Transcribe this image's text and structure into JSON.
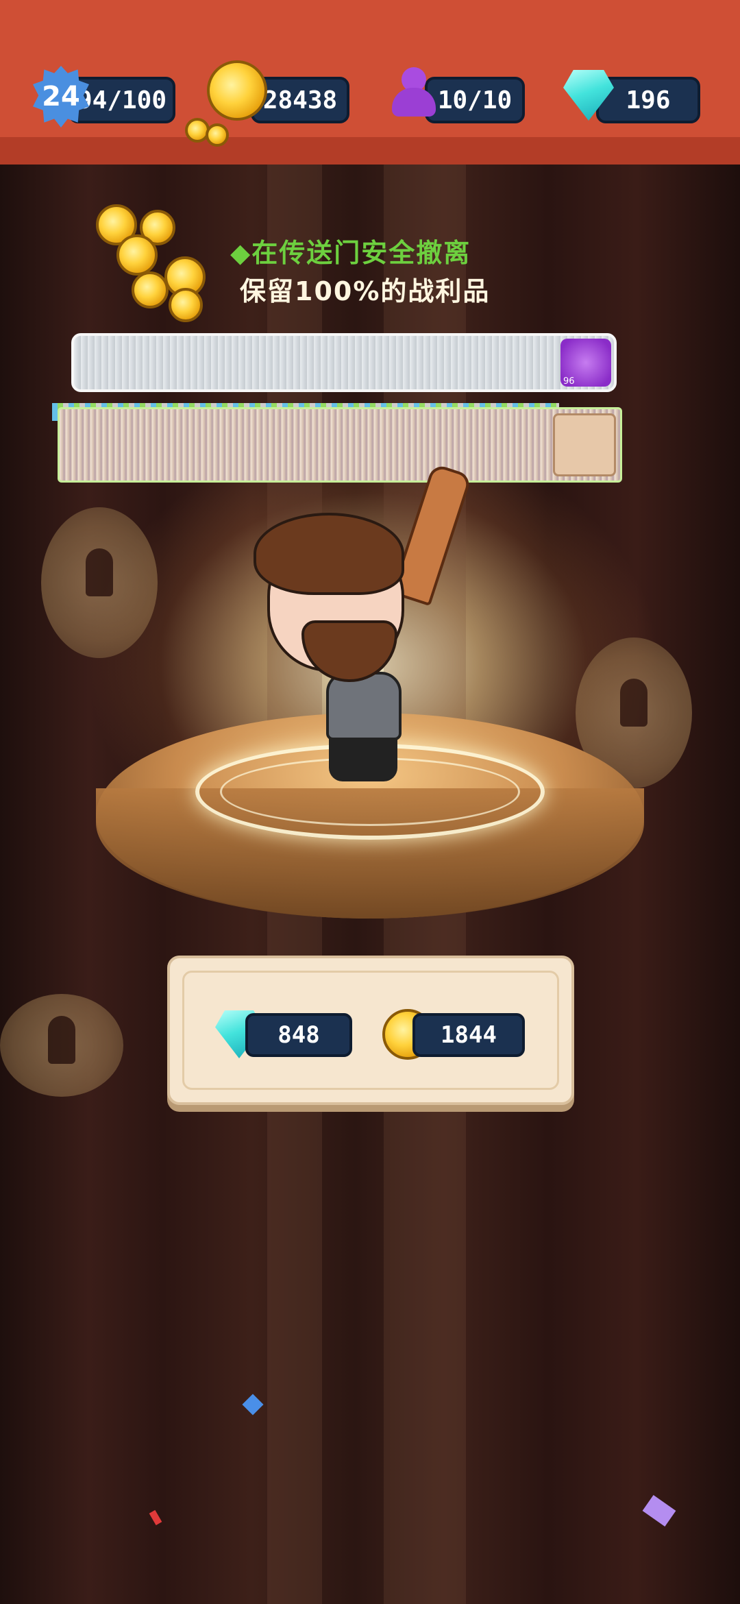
{
  "hud": {
    "level": "24",
    "energy": "94/100",
    "gold": "28438",
    "members": "10/10",
    "gems": "196"
  },
  "tip": {
    "line1": "◆在传送门安全撤离",
    "line2": "保留100%的战利品"
  },
  "loot": {
    "item_level": "96"
  },
  "rewards": {
    "gems": "848",
    "gold": "1844"
  },
  "colors": {
    "hud_bg": "#cf4f35",
    "pill_bg": "#1b3150",
    "tip_green": "#6dd03f",
    "panel_bg": "#f6e6cf"
  }
}
